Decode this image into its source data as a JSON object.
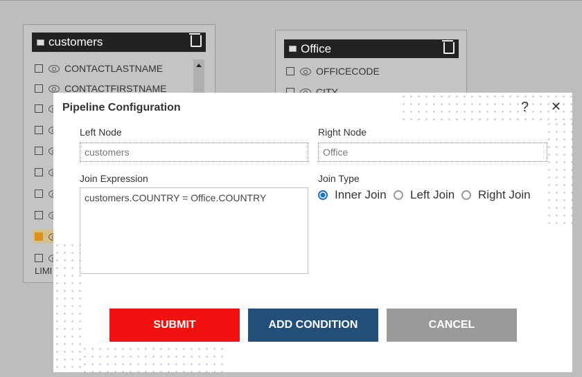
{
  "customers": {
    "title": "customers",
    "rows": [
      {
        "label": "CONTACTLASTNAME",
        "checked": false
      },
      {
        "label": "CONTACTFIRSTNAME",
        "checked": false
      },
      {
        "label": "",
        "checked": false
      },
      {
        "label": "",
        "checked": false
      },
      {
        "label": "",
        "checked": false
      },
      {
        "label": "",
        "checked": false
      },
      {
        "label": "",
        "checked": false
      },
      {
        "label": "",
        "checked": false
      },
      {
        "label": "",
        "checked": true
      },
      {
        "label": "",
        "checked": false
      }
    ],
    "partial_label": "LIMI"
  },
  "office": {
    "title": "Office",
    "rows": [
      {
        "label": "OFFICECODE"
      },
      {
        "label": "CITY"
      }
    ]
  },
  "modal": {
    "title": "Pipeline Configuration",
    "help": "?",
    "close": "✕",
    "left_node_label": "Left Node",
    "left_node_value": "customers",
    "right_node_label": "Right Node",
    "right_node_value": "Office",
    "join_expression_label": "Join Expression",
    "join_expression_value": "customers.COUNTRY = Office.COUNTRY",
    "join_type_label": "Join Type",
    "join_types": [
      {
        "label": "Inner Join",
        "selected": true
      },
      {
        "label": "Left Join",
        "selected": false
      },
      {
        "label": "Right Join",
        "selected": false
      }
    ],
    "submit": "SUBMIT",
    "add_condition": "ADD CONDITION",
    "cancel": "CANCEL"
  },
  "colors": {
    "submit": "#f21111",
    "add_condition": "#234f78",
    "cancel": "#9a9a9a",
    "radio": "#1a73c8",
    "checked": "#e0901c"
  }
}
